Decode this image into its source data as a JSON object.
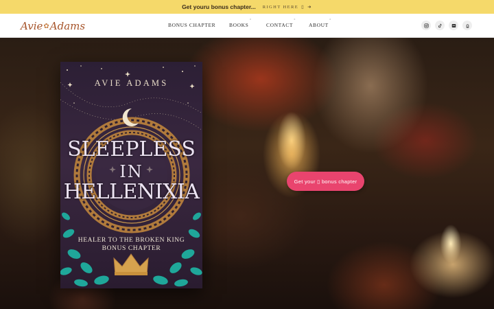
{
  "announcement": {
    "message": "Get youru bonus chapter...",
    "link_label": "RIGHT HERE",
    "link_glyph": "▯",
    "arrow": "➜"
  },
  "header": {
    "logo_text_1": "Avie",
    "logo_text_2": "Adams",
    "nav": [
      {
        "label": "BONUS CHAPTER",
        "has_submenu": false
      },
      {
        "label": "BOOKS",
        "has_submenu": true
      },
      {
        "label": "CONTACT",
        "has_submenu": true
      },
      {
        "label": "ABOUT",
        "has_submenu": true
      }
    ],
    "submenu_marker": "°",
    "social_icons": [
      "instagram-icon",
      "tiktok-icon",
      "linkedin-icon",
      "amazon-icon"
    ]
  },
  "book": {
    "author": "AVIE ADAMS",
    "title_line_1": "SLEEPLESS",
    "title_line_2": "IN",
    "title_line_3": "HELLENIXIA",
    "subtitle_line_1": "HEALER TO THE BROKEN KING",
    "subtitle_line_2": "BONUS CHAPTER"
  },
  "cta": {
    "label": "Get your ▯ bonus chapter"
  },
  "colors": {
    "announcement_bg": "#f5d96a",
    "cta_bg": "#e9446e",
    "logo": "#a6542a",
    "book_bg": "#2c1f35",
    "leaves": "#1fa79a",
    "gold": "#c8964e"
  }
}
